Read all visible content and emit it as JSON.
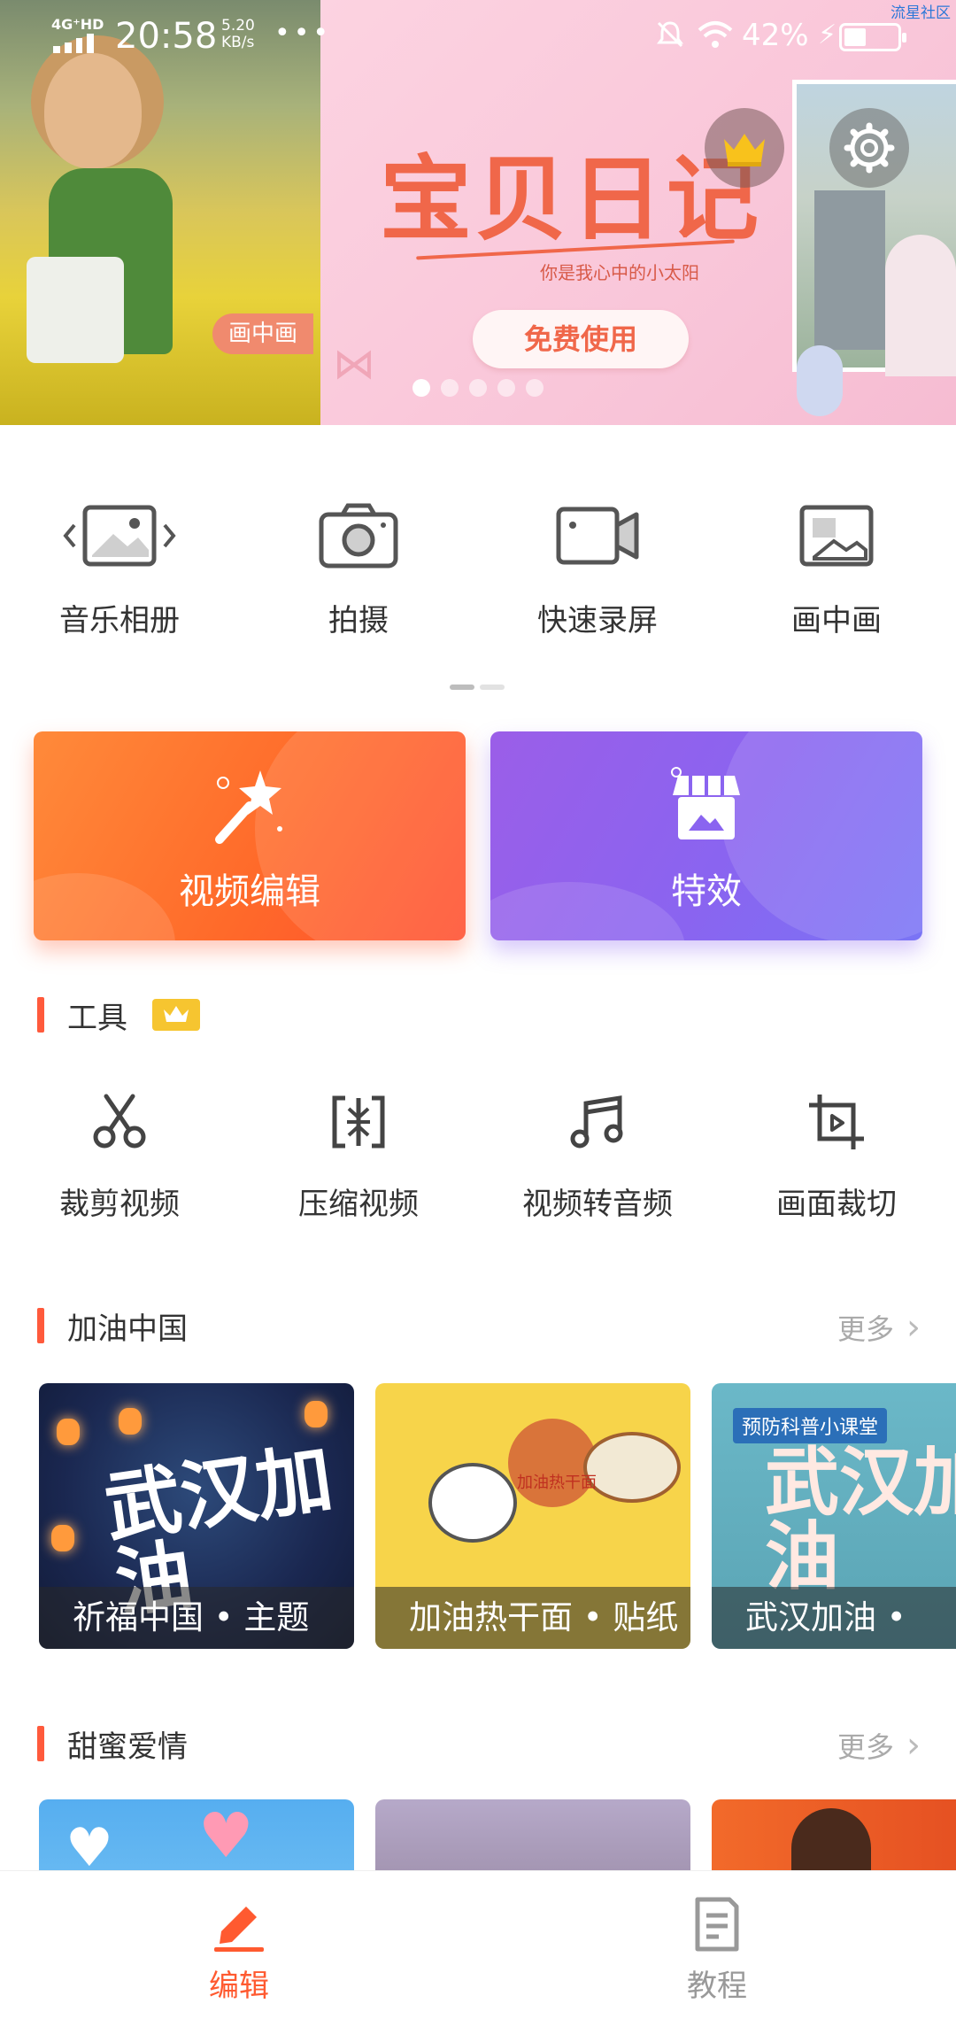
{
  "status_bar": {
    "network": "4G⁺HD",
    "time": "20:58",
    "speed": "5.20\nKB/s",
    "more": "•••",
    "battery_percent": "42%",
    "battery_level": 0.42,
    "community_label": "流星社区"
  },
  "banner": {
    "left_tag": "画中画",
    "title": "宝贝日记",
    "subtitle": "你是我心中的小太阳",
    "cta": "免费使用",
    "dot_count": 5,
    "active_dot": 0
  },
  "quick_actions": [
    {
      "label": "音乐相册",
      "icon": "music-album-icon"
    },
    {
      "label": "拍摄",
      "icon": "camera-icon"
    },
    {
      "label": "快速录屏",
      "icon": "screen-record-icon"
    },
    {
      "label": "画中画",
      "icon": "picture-in-picture-icon"
    }
  ],
  "cards": {
    "edit": {
      "label": "视频编辑",
      "icon": "magic-wand-icon",
      "color": "#ff6a2a"
    },
    "effects": {
      "label": "特效",
      "icon": "store-icon",
      "color": "#8a64f0"
    }
  },
  "tools_section": {
    "title": "工具",
    "badge_icon": "crown-icon",
    "items": [
      {
        "label": "裁剪视频",
        "icon": "scissors-icon"
      },
      {
        "label": "压缩视频",
        "icon": "compress-icon"
      },
      {
        "label": "视频转音频",
        "icon": "music-note-icon"
      },
      {
        "label": "画面裁切",
        "icon": "crop-icon"
      }
    ]
  },
  "section_china": {
    "title": "加油中国",
    "more": "更多",
    "items": [
      {
        "caption": "祈福中国 • 主题",
        "art": "武汉加油"
      },
      {
        "caption": "加油热干面 • 贴纸",
        "art": "加油热干面"
      },
      {
        "caption": "武汉加油 •",
        "art": "武汉加油",
        "tag": "预防科普小课堂"
      }
    ]
  },
  "section_love": {
    "title": "甜蜜爱情",
    "more": "更多"
  },
  "bottom_nav": [
    {
      "label": "编辑",
      "icon": "edit-icon",
      "active": true
    },
    {
      "label": "教程",
      "icon": "tutorial-icon",
      "active": false
    }
  ],
  "colors": {
    "accent": "#ff5a3c",
    "edit_gradient": "#ff6a2a",
    "effects_gradient": "#8a64f0",
    "vip_badge": "#f6c530"
  }
}
